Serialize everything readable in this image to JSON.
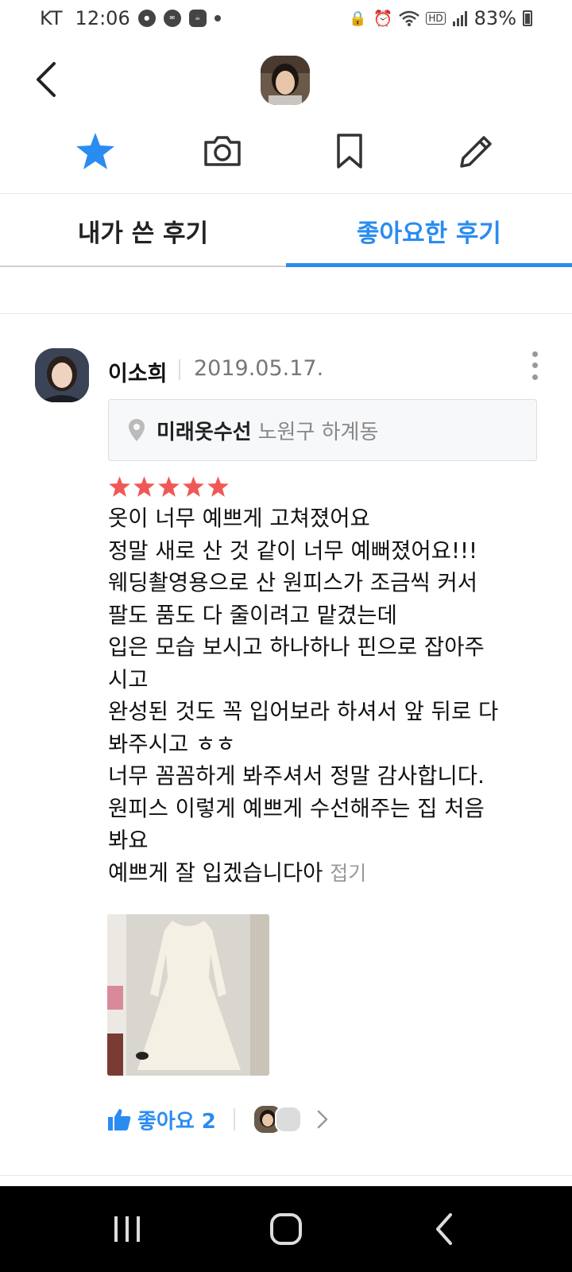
{
  "status_bar": {
    "carrier": "KT",
    "time": "12:06",
    "battery": "83%"
  },
  "header": {
    "back_icon": "chevron-left-icon"
  },
  "actions": [
    {
      "name": "star-icon",
      "color": "#2a8cf0"
    },
    {
      "name": "camera-icon",
      "color": "#333333"
    },
    {
      "name": "bookmark-icon",
      "color": "#333333"
    },
    {
      "name": "pencil-icon",
      "color": "#333333"
    }
  ],
  "tabs": [
    {
      "label": "내가 쓴 후기",
      "active": false
    },
    {
      "label": "좋아요한 후기",
      "active": true
    }
  ],
  "review": {
    "author": "이소희",
    "date": "2019.05.17.",
    "place": {
      "name": "미래옷수선",
      "area": "노원구 하계동"
    },
    "rating": 5,
    "star_color": "#f25757",
    "lines": [
      "옷이 너무 예쁘게 고쳐졌어요",
      "정말 새로 산 것 같이 너무 예뻐졌어요!!!",
      "웨딩촬영용으로 산 원피스가 조금씩 커서",
      "팔도 품도 다 줄이려고 맡겼는데",
      "입은 모습 보시고 하나하나 핀으로 잡아주",
      "시고",
      "완성된 것도 꼭 입어보라 하셔서 앞 뒤로 다",
      "봐주시고 ㅎㅎ",
      "너무 꼼꼼하게 봐주셔서 정말 감사합니다.",
      "원피스 이렇게 예쁘게 수선해주는 집 처음",
      "봐요",
      "예쁘게 잘 입겠습니다아"
    ],
    "fold_label": "접기",
    "like_label": "좋아요 2",
    "accent": "#2a8cf0"
  }
}
